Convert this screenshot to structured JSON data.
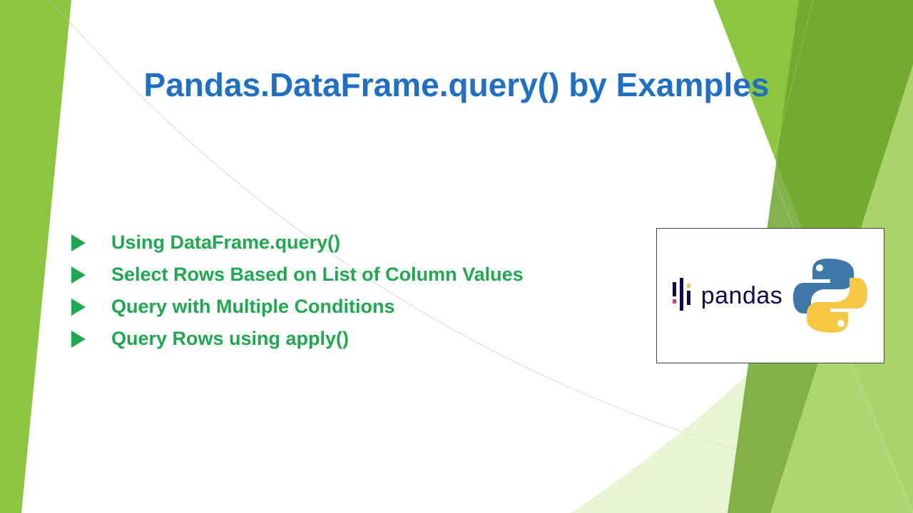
{
  "title": "Pandas.DataFrame.query() by Examples",
  "bullets": [
    "Using DataFrame.query()",
    "Select Rows Based on List of Column Values",
    "Query with Multiple Conditions",
    "Query Rows using apply()"
  ],
  "logo": {
    "pandas_text": "pandas"
  },
  "colors": {
    "title": "#1f6fc5",
    "accent": "#1fa84f",
    "green_main": "#8cc63e",
    "green_dark": "#6fa52e",
    "green_light": "#b8de7a"
  }
}
